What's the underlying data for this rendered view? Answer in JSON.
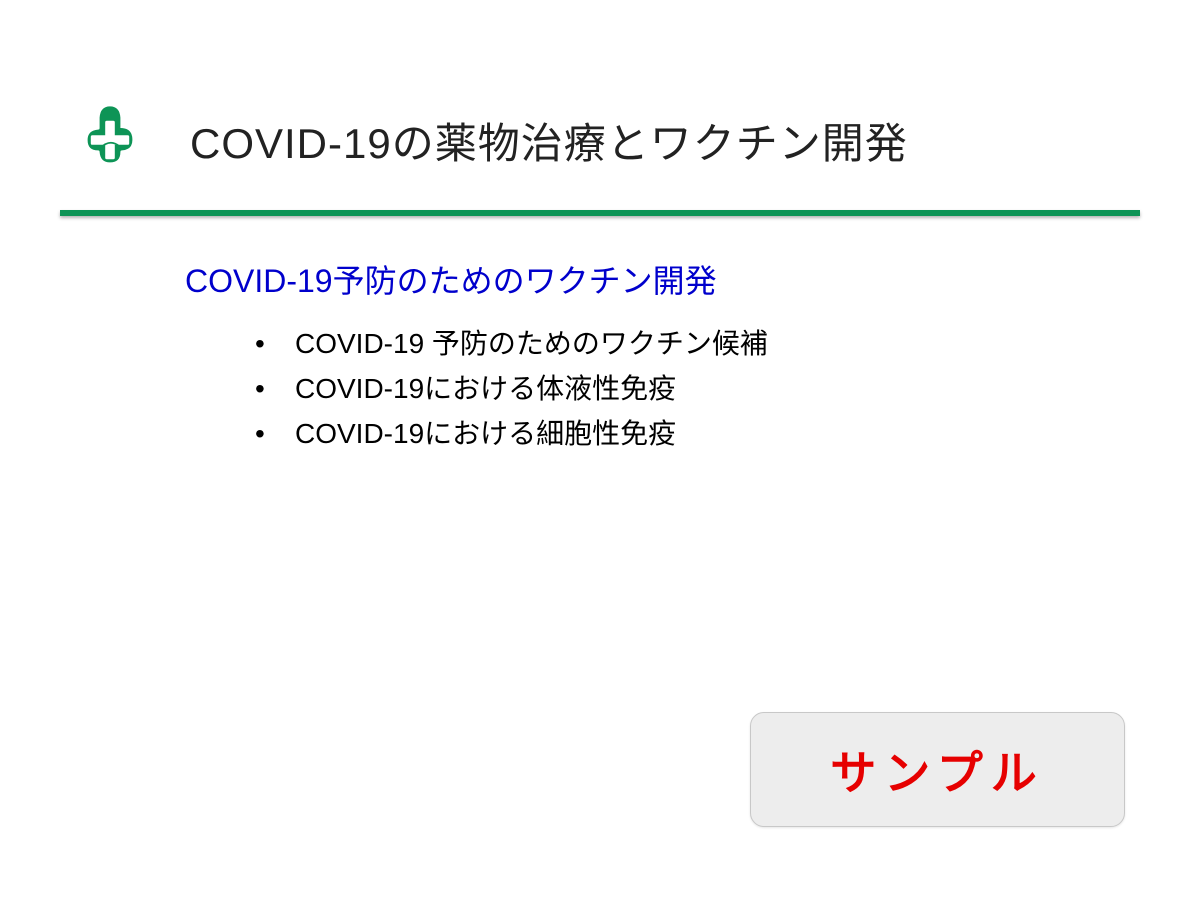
{
  "header": {
    "title": "COVID-19の薬物治療とワクチン開発"
  },
  "content": {
    "section_title": "COVID-19予防のためのワクチン開発",
    "bullets": [
      "COVID-19 予防のためのワクチン候補",
      "COVID-19における体液性免疫",
      "COVID-19における細胞性免疫"
    ]
  },
  "badge": {
    "label": "サンプル"
  },
  "colors": {
    "accent_green": "#0d9456",
    "title_blue": "#0000cc",
    "badge_red": "#e60000"
  }
}
